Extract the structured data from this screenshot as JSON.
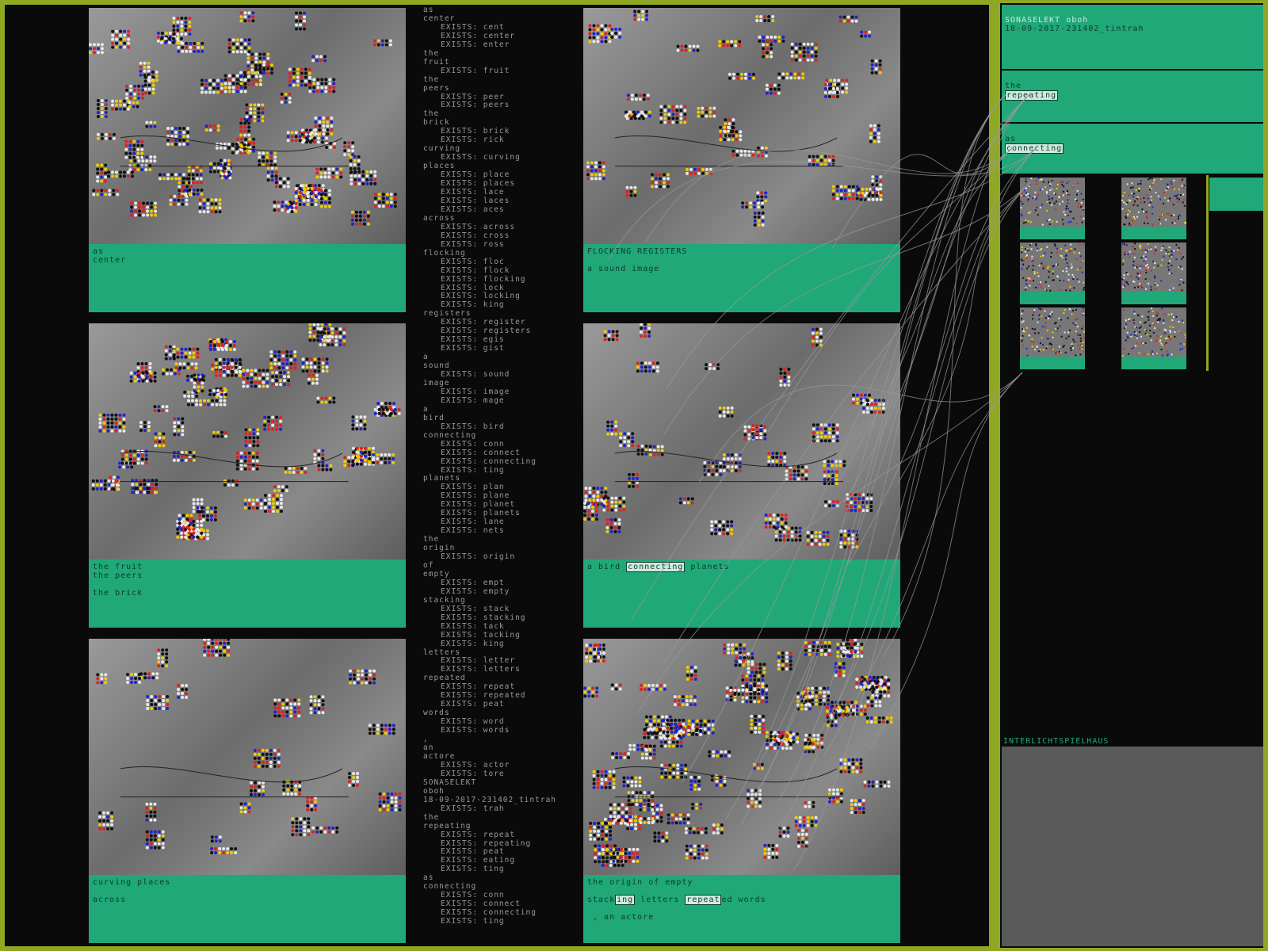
{
  "panels": [
    {
      "caption_lines": [
        "as",
        "center"
      ]
    },
    {
      "caption_lines": [
        "FLOCKING REGISTERS",
        "",
        "a sound image"
      ]
    },
    {
      "caption_lines": [
        "the fruit",
        "the peers",
        "",
        "the brick"
      ]
    },
    {
      "caption_lines": [
        "a bird [connecting] planets"
      ]
    },
    {
      "caption_lines": [
        "curving places",
        "",
        "across"
      ]
    },
    {
      "caption_lines": [
        "the origin of empty",
        "",
        "stack[ing] letters [repeat]ed words",
        "",
        " , an actore"
      ]
    }
  ],
  "wordlist": [
    {
      "w": "as"
    },
    {
      "w": "center",
      "e": [
        "EXISTS: cent",
        "EXISTS: center",
        "EXISTS: enter"
      ]
    },
    {
      "w": "the"
    },
    {
      "w": "fruit",
      "e": [
        "EXISTS: fruit"
      ]
    },
    {
      "w": "the"
    },
    {
      "w": "peers",
      "e": [
        "EXISTS: peer",
        "EXISTS: peers"
      ]
    },
    {
      "w": "the"
    },
    {
      "w": "brick",
      "e": [
        "EXISTS: brick",
        "EXISTS: rick"
      ]
    },
    {
      "w": "curving",
      "e": [
        "EXISTS: curving"
      ]
    },
    {
      "w": "places",
      "e": [
        "EXISTS: place",
        "EXISTS: places",
        "EXISTS: lace",
        "EXISTS: laces",
        "EXISTS: aces"
      ]
    },
    {
      "w": "across",
      "e": [
        "EXISTS: across",
        "EXISTS: cross",
        "EXISTS: ross"
      ]
    },
    {
      "w": "flocking",
      "e": [
        "EXISTS: floc",
        "EXISTS: flock",
        "EXISTS: flocking",
        "EXISTS: lock",
        "EXISTS: locking",
        "EXISTS: king"
      ]
    },
    {
      "w": "registers",
      "e": [
        "EXISTS: register",
        "EXISTS: registers",
        "EXISTS: egis",
        "EXISTS: gist"
      ]
    },
    {
      "w": "a"
    },
    {
      "w": "sound",
      "e": [
        "EXISTS: sound"
      ]
    },
    {
      "w": "image",
      "e": [
        "EXISTS: image",
        "EXISTS: mage"
      ]
    },
    {
      "w": "a"
    },
    {
      "w": "bird",
      "e": [
        "EXISTS: bird"
      ]
    },
    {
      "w": "connecting",
      "e": [
        "EXISTS: conn",
        "EXISTS: connect",
        "EXISTS: connecting",
        "EXISTS: ting"
      ]
    },
    {
      "w": "planets",
      "e": [
        "EXISTS: plan",
        "EXISTS: plane",
        "EXISTS: planet",
        "EXISTS: planets",
        "EXISTS: lane",
        "EXISTS: nets"
      ]
    },
    {
      "w": "the"
    },
    {
      "w": "origin",
      "e": [
        "EXISTS: origin"
      ]
    },
    {
      "w": "of"
    },
    {
      "w": "empty",
      "e": [
        "EXISTS: empt",
        "EXISTS: empty"
      ]
    },
    {
      "w": "stacking",
      "e": [
        "EXISTS: stack",
        "EXISTS: stacking",
        "EXISTS: tack",
        "EXISTS: tacking",
        "EXISTS: king"
      ]
    },
    {
      "w": "letters",
      "e": [
        "EXISTS: letter",
        "EXISTS: letters"
      ]
    },
    {
      "w": "repeated",
      "e": [
        "EXISTS: repeat",
        "EXISTS: repeated",
        "EXISTS: peat"
      ]
    },
    {
      "w": "words",
      "e": [
        "EXISTS: word",
        "EXISTS: words"
      ]
    },
    {
      "w": ","
    },
    {
      "w": "an"
    },
    {
      "w": "actore",
      "e": [
        "EXISTS: actor",
        "EXISTS: tore"
      ]
    },
    {
      "w": "SONASELEKT"
    },
    {
      "w": "oboh"
    },
    {
      "w": "18-09-2017-231402_tintrah",
      "e": [
        "EXISTS: trah"
      ]
    },
    {
      "w": "the"
    },
    {
      "w": "repeating",
      "e": [
        "EXISTS: repeat",
        "EXISTS: repeating",
        "EXISTS: peat",
        "EXISTS: eating",
        "EXISTS: ting"
      ]
    },
    {
      "w": "as"
    },
    {
      "w": "connecting",
      "e": [
        "EXISTS: conn",
        "EXISTS: connect",
        "EXISTS: connecting",
        "EXISTS: ting"
      ]
    }
  ],
  "sidebar": {
    "title": "SONASELEKT oboh",
    "session": "18-09-2017-231402_tintrah",
    "block1_word": "the",
    "block1_box": "repeating",
    "block2_word": "as",
    "block2_box": "connecting",
    "lower_label": "INTERLICHTSPIELHAUS"
  },
  "colors": {
    "background": "#8fa823",
    "caption": "#20a878",
    "caption_text": "#0d3b2b",
    "list_text": "#9a9a9a"
  }
}
